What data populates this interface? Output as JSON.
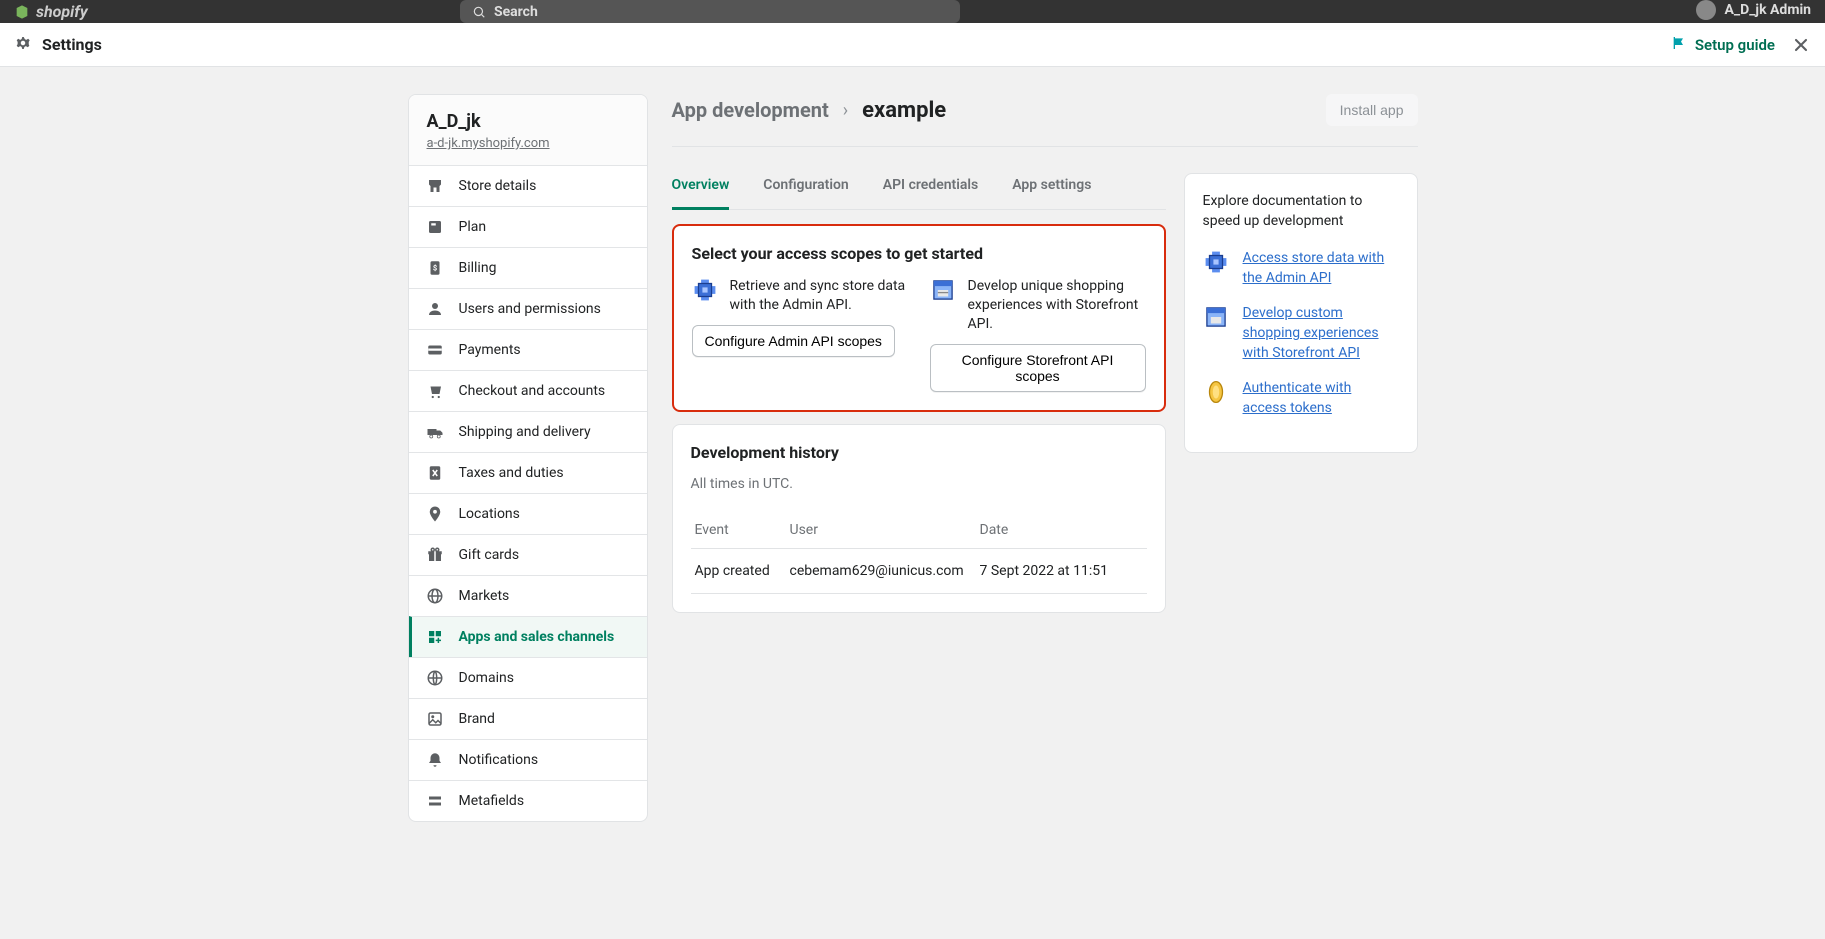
{
  "topbar": {
    "brand": "shopify",
    "search_placeholder": "Search",
    "user_name": "A_D_jk Admin"
  },
  "settings_bar": {
    "title": "Settings",
    "setup_guide": "Setup guide"
  },
  "sidebar": {
    "store_name": "A_D_jk",
    "store_url": "a-d-jk.myshopify.com",
    "items": [
      {
        "label": "Store details",
        "icon": "store-icon"
      },
      {
        "label": "Plan",
        "icon": "plan-icon"
      },
      {
        "label": "Billing",
        "icon": "billing-icon"
      },
      {
        "label": "Users and permissions",
        "icon": "users-icon"
      },
      {
        "label": "Payments",
        "icon": "payments-icon"
      },
      {
        "label": "Checkout and accounts",
        "icon": "checkout-icon"
      },
      {
        "label": "Shipping and delivery",
        "icon": "shipping-icon"
      },
      {
        "label": "Taxes and duties",
        "icon": "taxes-icon"
      },
      {
        "label": "Locations",
        "icon": "locations-icon"
      },
      {
        "label": "Gift cards",
        "icon": "gift-icon"
      },
      {
        "label": "Markets",
        "icon": "markets-icon"
      },
      {
        "label": "Apps and sales channels",
        "icon": "apps-icon",
        "active": true
      },
      {
        "label": "Domains",
        "icon": "domains-icon"
      },
      {
        "label": "Brand",
        "icon": "brand-icon"
      },
      {
        "label": "Notifications",
        "icon": "notifications-icon"
      },
      {
        "label": "Metafields",
        "icon": "metafields-icon"
      }
    ]
  },
  "breadcrumb": {
    "parent": "App development",
    "current": "example",
    "install_button": "Install app"
  },
  "tabs": [
    "Overview",
    "Configuration",
    "API credentials",
    "App settings"
  ],
  "scopes_card": {
    "title": "Select your access scopes to get started",
    "admin": {
      "desc": "Retrieve and sync store data with the Admin API.",
      "button": "Configure Admin API scopes"
    },
    "storefront": {
      "desc": "Develop unique shopping experiences with Storefront API.",
      "button": "Configure Storefront API scopes"
    }
  },
  "history_card": {
    "title": "Development history",
    "subtext": "All times in UTC.",
    "headers": {
      "event": "Event",
      "user": "User",
      "date": "Date"
    },
    "rows": [
      {
        "event": "App created",
        "user": "cebemam629@iunicus.com",
        "date": "7 Sept 2022 at 11:51"
      }
    ]
  },
  "docs_card": {
    "intro": "Explore documentation to speed up development",
    "links": [
      "Access store data with the Admin API",
      "Develop custom shopping experiences with Storefront API",
      "Authenticate with access tokens"
    ]
  }
}
